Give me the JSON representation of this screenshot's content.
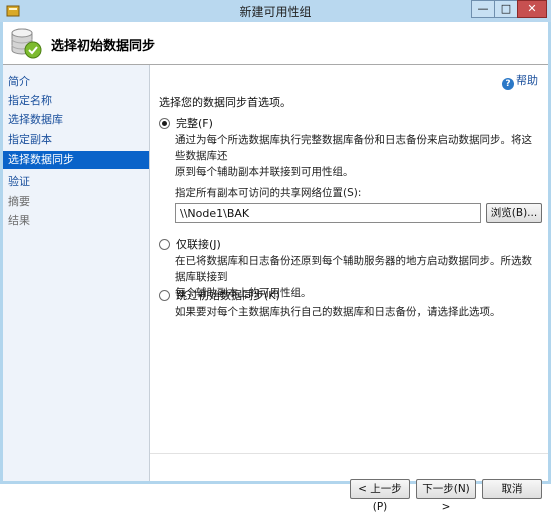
{
  "window": {
    "title": "新建可用性组",
    "controls": {
      "minimize": "—",
      "maximize": "□",
      "close": "✕"
    }
  },
  "header": {
    "title": "选择初始数据同步"
  },
  "nav": {
    "items": [
      {
        "label": "简介",
        "state": "link"
      },
      {
        "label": "指定名称",
        "state": "link"
      },
      {
        "label": "选择数据库",
        "state": "link"
      },
      {
        "label": "指定副本",
        "state": "link"
      },
      {
        "label": "选择数据同步",
        "state": "selected"
      },
      {
        "label": "验证",
        "state": "link"
      },
      {
        "label": "摘要",
        "state": "disabled"
      },
      {
        "label": "结果",
        "state": "disabled"
      }
    ]
  },
  "main": {
    "help_label": "帮助",
    "prompt": "选择您的数据同步首选项。",
    "options": {
      "full": {
        "label": "完整(F)",
        "checked": true,
        "description_line1": "通过为每个所选数据库执行完整数据库备份和日志备份来启动数据同步。将这些数据库还",
        "description_line2": "原到每个辅助副本并联接到可用性组。",
        "share_label": "指定所有副本可访问的共享网络位置(S):",
        "share_value": "\\\\Node1\\BAK",
        "browse_label": "浏览(B)..."
      },
      "join_only": {
        "label": "仅联接(J)",
        "checked": false,
        "description_line1": "在已将数据库和日志备份还原到每个辅助服务器的地方启动数据同步。所选数据库联接到",
        "description_line2": "每个辅助副本上的可用性组。"
      },
      "skip": {
        "label": "跳过初始数据同步(K)",
        "checked": false,
        "description_line1": "如果要对每个主数据库执行自己的数据库和日志备份，请选择此选项。"
      }
    }
  },
  "footer": {
    "previous_label": "< 上一步(P)",
    "next_label": "下一步(N) >",
    "cancel_label": "取消"
  },
  "colors": {
    "titlebar": "#b9d8ef",
    "nav_background": "#eef3fa",
    "nav_selected": "#0a63c9",
    "link": "#1a4f9c"
  }
}
